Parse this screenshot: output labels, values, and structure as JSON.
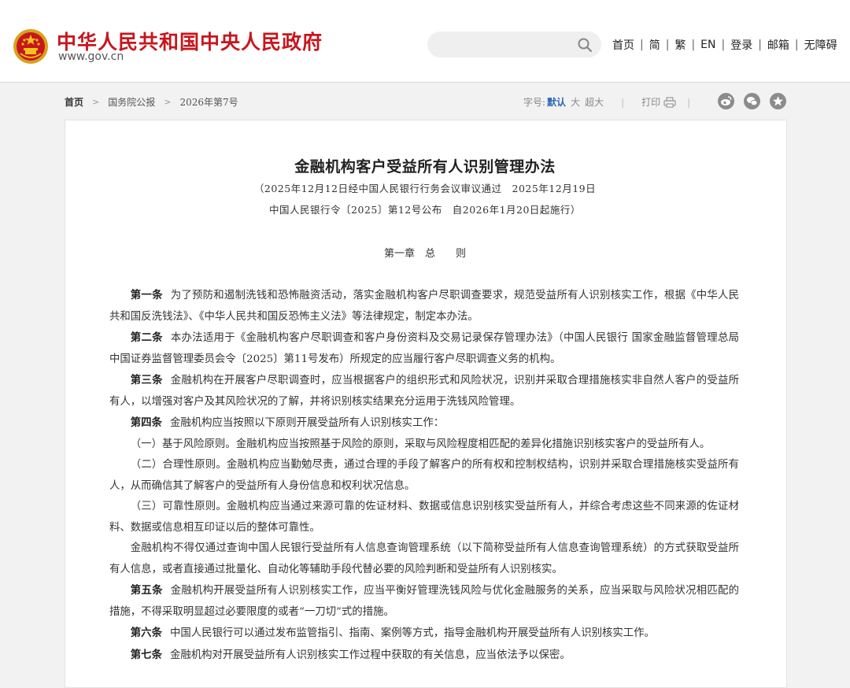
{
  "site": {
    "title": "中华人民共和国中央人民政府",
    "domain": "www.gov.cn"
  },
  "search": {
    "placeholder": ""
  },
  "topnav": [
    "首页",
    "简",
    "繁",
    "EN",
    "登录",
    "邮箱",
    "无障碍"
  ],
  "breadcrumb": {
    "home": "首页",
    "section": "国务院公报",
    "issue": "2026年第7号"
  },
  "tools": {
    "font_label": "字号:",
    "font_default": "默认",
    "font_large": "大",
    "font_xlarge": "超大",
    "print": "打印"
  },
  "share_icons": [
    "weibo-icon",
    "wechat-icon",
    "favorite-icon"
  ],
  "document": {
    "title": "金融机构客户受益所有人识别管理办法",
    "subtitle_line1": "（2025年12月12日经中国人民银行行务会议审议通过　2025年12月19日",
    "subtitle_line2": "中国人民银行令〔2025〕第12号公布　自2026年1月20日起施行）",
    "chapter": "第一章　总　　则",
    "paragraphs": [
      {
        "lead": "第一条",
        "text": "为了预防和遏制洗钱和恐怖融资活动，落实金融机构客户尽职调查要求，规范受益所有人识别核实工作，根据《中华人民共和国反洗钱法》、《中华人民共和国反恐怖主义法》等法律规定，制定本办法。"
      },
      {
        "lead": "第二条",
        "text": "本办法适用于《金融机构客户尽职调查和客户身份资料及交易记录保存管理办法》（中国人民银行 国家金融监督管理总局 中国证券监督管理委员会令〔2025〕第11号发布）所规定的应当履行客户尽职调查义务的机构。"
      },
      {
        "lead": "第三条",
        "text": "金融机构在开展客户尽职调查时，应当根据客户的组织形式和风险状况，识别并采取合理措施核实非自然人客户的受益所有人，以增强对客户及其风险状况的了解，并将识别核实结果充分运用于洗钱风险管理。"
      },
      {
        "lead": "第四条",
        "text": "金融机构应当按照以下原则开展受益所有人识别核实工作："
      },
      {
        "lead": "",
        "text": "（一）基于风险原则。金融机构应当按照基于风险的原则，采取与风险程度相匹配的差异化措施识别核实客户的受益所有人。"
      },
      {
        "lead": "",
        "text": "（二）合理性原则。金融机构应当勤勉尽责，通过合理的手段了解客户的所有权和控制权结构，识别并采取合理措施核实受益所有人，从而确信其了解客户的受益所有人身份信息和权利状况信息。"
      },
      {
        "lead": "",
        "text": "（三）可靠性原则。金融机构应当通过来源可靠的佐证材料、数据或信息识别核实受益所有人，并综合考虑这些不同来源的佐证材料、数据或信息相互印证以后的整体可靠性。"
      },
      {
        "lead": "",
        "text": "金融机构不得仅通过查询中国人民银行受益所有人信息查询管理系统（以下简称受益所有人信息查询管理系统）的方式获取受益所有人信息，或者直接通过批量化、自动化等辅助手段代替必要的风险判断和受益所有人识别核实。"
      },
      {
        "lead": "第五条",
        "text": "金融机构开展受益所有人识别核实工作，应当平衡好管理洗钱风险与优化金融服务的关系，应当采取与风险状况相匹配的措施，不得采取明显超过必要限度的或者“一刀切”式的措施。"
      },
      {
        "lead": "第六条",
        "text": "中国人民银行可以通过发布监管指引、指南、案例等方式，指导金融机构开展受益所有人识别核实工作。"
      },
      {
        "lead": "第七条",
        "text": "金融机构对开展受益所有人识别核实工作过程中获取的有关信息，应当依法予以保密。"
      }
    ]
  },
  "colors": {
    "brand_red": "#c8161d",
    "link_blue": "#2b68b5",
    "background": "#f2f2f2"
  }
}
